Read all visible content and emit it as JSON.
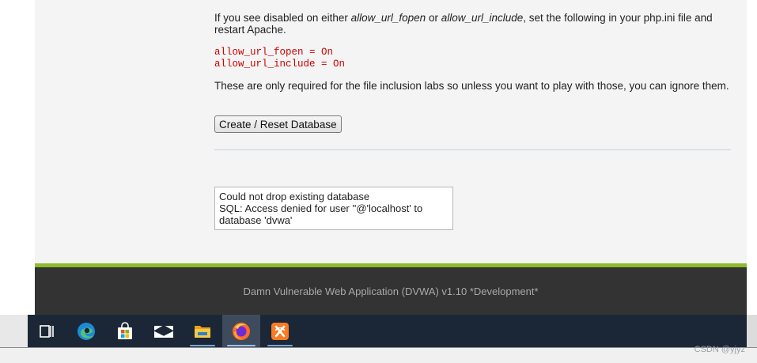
{
  "intro": {
    "prefix": "If you see disabled on either ",
    "fopen": "allow_url_fopen",
    "or": " or ",
    "include": "allow_url_include",
    "suffix": ", set the following in your php.ini file and restart Apache."
  },
  "code_lines": [
    "allow_url_fopen = On",
    "allow_url_include = On"
  ],
  "note": "These are only required for the file inclusion labs so unless you want to play with those, you can ignore them.",
  "reset_button": "Create / Reset Database",
  "message": {
    "line1": "Could not drop existing database",
    "line2": "SQL: Access denied for user ''@'localhost' to",
    "line3": "database 'dvwa'"
  },
  "footer": "Damn Vulnerable Web Application (DVWA) v1.10 *Development*",
  "taskbar": {
    "icons": [
      "task-view-icon",
      "edge-icon",
      "store-icon",
      "mail-icon",
      "file-explorer-icon",
      "firefox-icon",
      "xampp-icon"
    ],
    "active": "firefox-icon"
  },
  "watermark": "CSDN @yjyz",
  "colors": {
    "code_red": "#cc0000",
    "accent_green": "#8dbb2a",
    "footer_bg": "#333333",
    "taskbar_bg": "#1b2736"
  }
}
